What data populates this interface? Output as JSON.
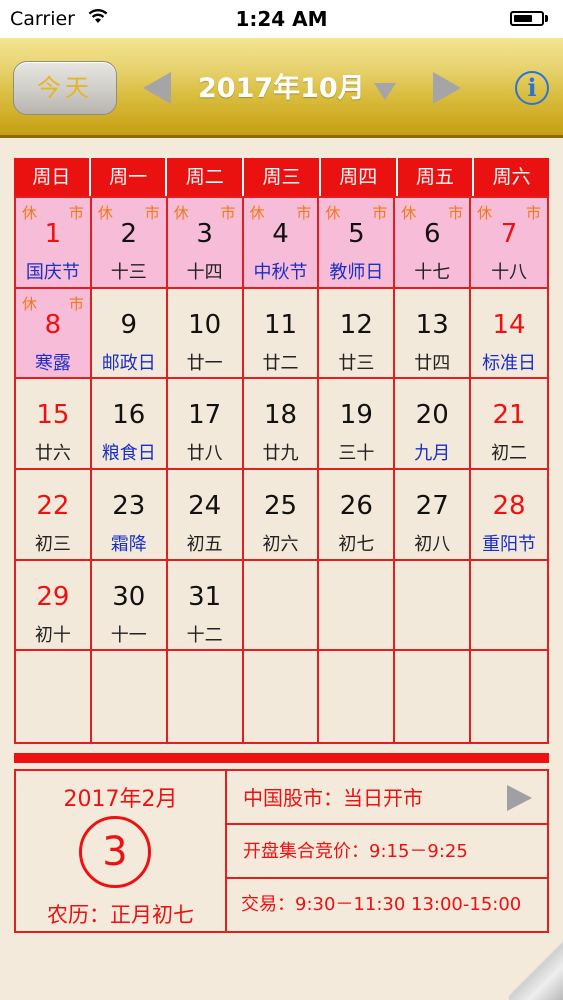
{
  "status_bar": {
    "carrier": "Carrier",
    "time": "1:24 AM",
    "battery_level": 0.7
  },
  "toolbar": {
    "today_label": "今天",
    "month_title": "2017年10月"
  },
  "colors": {
    "accent_red": "#ee1111",
    "festival_blue": "#1a2ec8",
    "holiday_pink": "#f7bcd7",
    "gold": "#d9bd3e",
    "tag_orange": "#f07a1a"
  },
  "weekdays": [
    "周日",
    "周一",
    "周二",
    "周三",
    "周四",
    "周五",
    "周六"
  ],
  "days": [
    {
      "day": "1",
      "lunar": "国庆节",
      "red": true,
      "festival": true,
      "holiday": true,
      "xiu": "休",
      "shi": "市"
    },
    {
      "day": "2",
      "lunar": "十三",
      "red": false,
      "festival": false,
      "holiday": true,
      "xiu": "休",
      "shi": "市"
    },
    {
      "day": "3",
      "lunar": "十四",
      "red": false,
      "festival": false,
      "holiday": true,
      "xiu": "休",
      "shi": "市"
    },
    {
      "day": "4",
      "lunar": "中秋节",
      "red": false,
      "festival": true,
      "holiday": true,
      "xiu": "休",
      "shi": "市"
    },
    {
      "day": "5",
      "lunar": "教师日",
      "red": false,
      "festival": true,
      "holiday": true,
      "xiu": "休",
      "shi": "市"
    },
    {
      "day": "6",
      "lunar": "十七",
      "red": false,
      "festival": false,
      "holiday": true,
      "xiu": "休",
      "shi": "市"
    },
    {
      "day": "7",
      "lunar": "十八",
      "red": true,
      "festival": false,
      "holiday": true,
      "xiu": "休",
      "shi": "市"
    },
    {
      "day": "8",
      "lunar": "寒露",
      "red": true,
      "festival": true,
      "holiday": true,
      "xiu": "休",
      "shi": "市"
    },
    {
      "day": "9",
      "lunar": "邮政日",
      "red": false,
      "festival": true
    },
    {
      "day": "10",
      "lunar": "廿一",
      "red": false,
      "festival": false
    },
    {
      "day": "11",
      "lunar": "廿二",
      "red": false,
      "festival": false
    },
    {
      "day": "12",
      "lunar": "廿三",
      "red": false,
      "festival": false
    },
    {
      "day": "13",
      "lunar": "廿四",
      "red": false,
      "festival": false
    },
    {
      "day": "14",
      "lunar": "标准日",
      "red": true,
      "festival": true
    },
    {
      "day": "15",
      "lunar": "廿六",
      "red": true,
      "festival": false
    },
    {
      "day": "16",
      "lunar": "粮食日",
      "red": false,
      "festival": true
    },
    {
      "day": "17",
      "lunar": "廿八",
      "red": false,
      "festival": false
    },
    {
      "day": "18",
      "lunar": "廿九",
      "red": false,
      "festival": false
    },
    {
      "day": "19",
      "lunar": "三十",
      "red": false,
      "festival": false
    },
    {
      "day": "20",
      "lunar": "九月",
      "red": false,
      "festival": true
    },
    {
      "day": "21",
      "lunar": "初二",
      "red": true,
      "festival": false
    },
    {
      "day": "22",
      "lunar": "初三",
      "red": true,
      "festival": false
    },
    {
      "day": "23",
      "lunar": "霜降",
      "red": false,
      "festival": true
    },
    {
      "day": "24",
      "lunar": "初五",
      "red": false,
      "festival": false
    },
    {
      "day": "25",
      "lunar": "初六",
      "red": false,
      "festival": false
    },
    {
      "day": "26",
      "lunar": "初七",
      "red": false,
      "festival": false
    },
    {
      "day": "27",
      "lunar": "初八",
      "red": false,
      "festival": false
    },
    {
      "day": "28",
      "lunar": "重阳节",
      "red": true,
      "festival": true
    },
    {
      "day": "29",
      "lunar": "初十",
      "red": true,
      "festival": false
    },
    {
      "day": "30",
      "lunar": "十一",
      "red": false,
      "festival": false
    },
    {
      "day": "31",
      "lunar": "十二",
      "red": false,
      "festival": false
    }
  ],
  "total_cells": 42,
  "info_panel": {
    "selected_date": "2017年2月",
    "selected_day": "3",
    "lunar_date": "农历：正月初七",
    "market_status": "中国股市：当日开市",
    "call_auction": "开盘集合竞价：9:15－9:25",
    "trading_hours": "交易：9:30－11:30 13:00-15:00"
  }
}
